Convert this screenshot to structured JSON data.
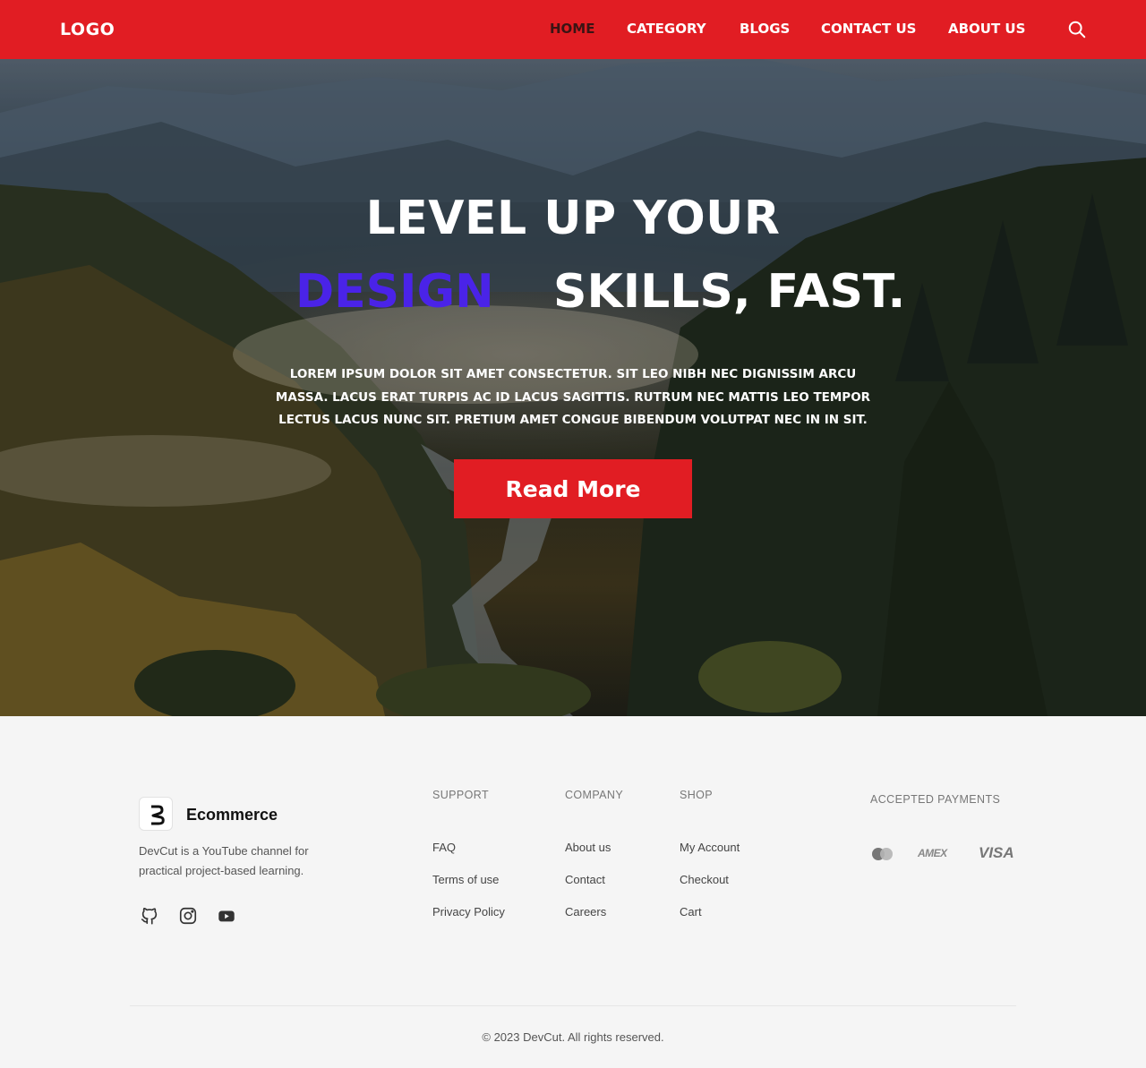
{
  "nav": {
    "logo": "LOGO",
    "links": [
      "HOME",
      "CATEGORY",
      "BLOGS",
      "CONTACT US",
      "ABOUT US"
    ],
    "active": "HOME",
    "search_icon": "search-icon"
  },
  "hero": {
    "line1": "LEVEL UP YOUR",
    "accent_word": "DESIGN",
    "line2_rest": "SKILLS, FAST.",
    "description": "LOREM IPSUM DOLOR SIT AMET CONSECTETUR. SIT LEO NIBH NEC DIGNISSIM ARCU MASSA. LACUS ERAT TURPIS AC ID LACUS SAGITTIS. RUTRUM NEC MATTIS LEO TEMPOR LECTUS LACUS NUNC SIT. PRETIUM AMET CONGUE BIBENDUM VOLUTPAT NEC IN IN SIT.",
    "button": "Read More"
  },
  "footer": {
    "brand": {
      "name": "Ecommerce",
      "description": "DevCut is a YouTube channel for practical project-based learning."
    },
    "social": [
      "github-icon",
      "instagram-icon",
      "youtube-icon"
    ],
    "columns": [
      {
        "title": "SUPPORT",
        "links": [
          "FAQ",
          "Terms of use",
          "Privacy Policy"
        ]
      },
      {
        "title": "COMPANY",
        "links": [
          "About us",
          "Contact",
          "Careers"
        ]
      },
      {
        "title": "SHOP",
        "links": [
          "My Account",
          "Checkout",
          "Cart"
        ]
      }
    ],
    "payments": {
      "title": "ACCEPTED PAYMENTS",
      "methods": [
        "mastercard-icon",
        "AMEX",
        "VISA"
      ]
    },
    "copyright": "© 2023 DevCut. All rights reserved."
  },
  "colors": {
    "primary": "#e11d23",
    "accent": "#4a23e8",
    "footer_bg": "#f5f5f5"
  }
}
